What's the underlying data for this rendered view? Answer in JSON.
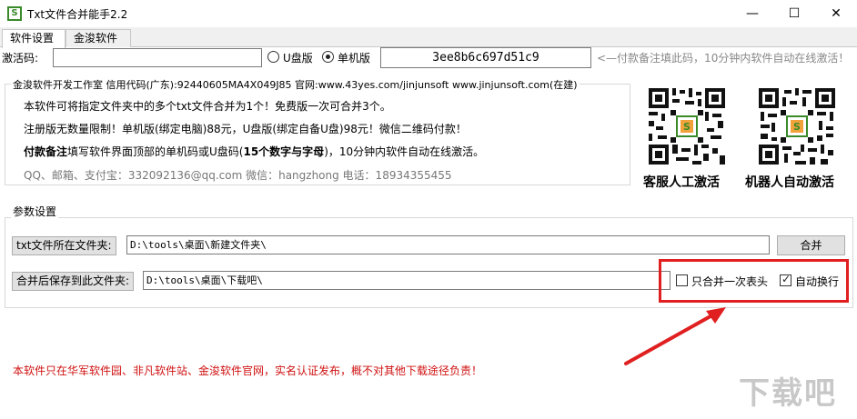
{
  "window": {
    "title": "Txt文件合并能手2.2",
    "icon_letter": "S",
    "minimize": "—",
    "maximize": "☐",
    "close": "✕"
  },
  "tabs": [
    {
      "label": "软件设置",
      "active": true
    },
    {
      "label": "金浚软件",
      "active": false
    }
  ],
  "activation": {
    "label": "激活码:",
    "value": "",
    "radio_usb_label": "U盘版",
    "radio_machine_label": "单机版",
    "selected": "单机版",
    "machine_code": "3ee8b6c697d51c9",
    "pay_notice": "<—付款备注填此码，10分钟内软件自动在线激活！"
  },
  "info": {
    "legend": "金浚软件开发工作室 信用代码(广东):92440605MA4X049J85 官网:www.43yes.com/jinjunsoft  www.jinjunsoft.com(在建)",
    "line1": "本软件可将指定文件夹中的多个txt文件合并为1个！免费版一次可合并3个。",
    "line2": "注册版无数量限制！单机版(绑定电脑)88元，U盘版(绑定自备U盘)98元！微信二维码付款！",
    "line3_bold": "付款备注",
    "line3_mid": "填写软件界面顶部的单机码或U盘码(",
    "line3_bold2": "15个数字与字母",
    "line3_end": ")，10分钟内软件自动在线激活。",
    "line4": "QQ、邮箱、支付宝：332092136@qq.com   微信：hangzhong   电话：18934355455"
  },
  "qr": {
    "left_caption": "客服人工激活",
    "right_caption": "机器人自动激活"
  },
  "params": {
    "legend": "参数设置",
    "source_label": "txt文件所在文件夹:",
    "source_value": "D:\\tools\\桌面\\新建文件夹\\",
    "merge_label": "合并",
    "dest_label": "合并后保存到此文件夹:",
    "dest_value": "D:\\tools\\桌面\\下载吧\\",
    "header_once_label": "只合并一次表头",
    "header_once_checked": false,
    "auto_wrap_label": "自动换行",
    "auto_wrap_checked": true
  },
  "footer_notice": "本软件只在华军软件园、非凡软件站、金浚软件官网，实名认证发布，概不对其他下载途径负责！",
  "watermark": "下载吧",
  "colors": {
    "highlight": "#e02020",
    "notice_red": "#d01010",
    "qr_logo": "#3a8a2a"
  }
}
